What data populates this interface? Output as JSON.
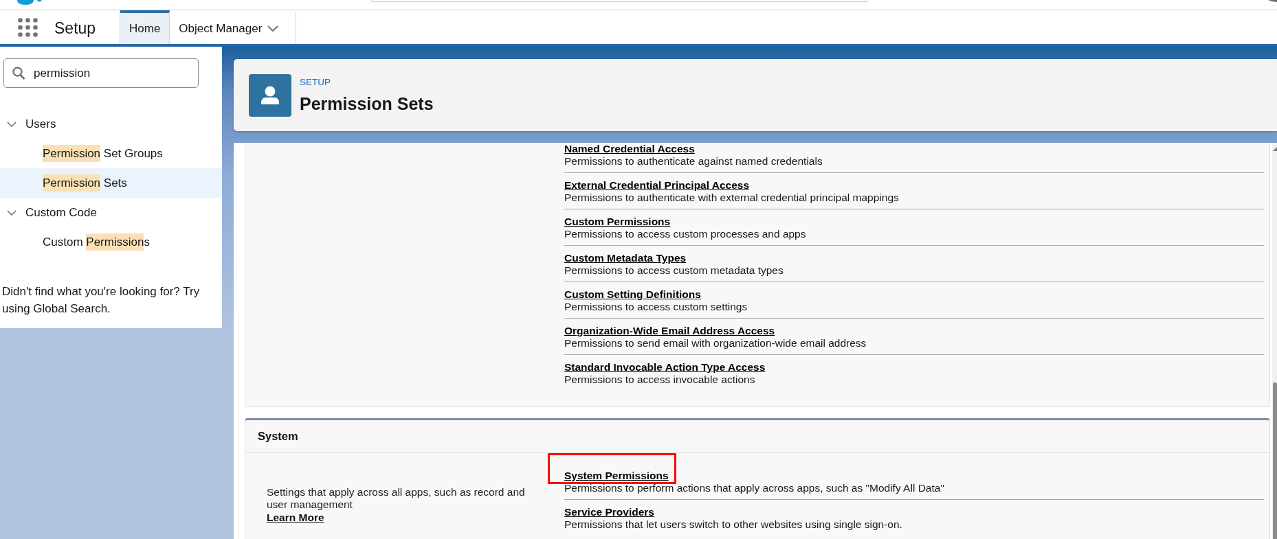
{
  "header": {
    "app_name": "Setup",
    "tabs": [
      {
        "label": "Home",
        "selected": true,
        "has_menu": false
      },
      {
        "label": "Object Manager",
        "selected": false,
        "has_menu": true
      }
    ]
  },
  "sidebar": {
    "search": {
      "value": "permission"
    },
    "tree": [
      {
        "label": "Users",
        "expanded": true,
        "children": [
          {
            "parts": [
              {
                "text": "Permission",
                "highlighted": true
              },
              {
                "text": " Set Groups",
                "highlighted": false
              }
            ],
            "selected": false
          },
          {
            "parts": [
              {
                "text": "Permission",
                "highlighted": true
              },
              {
                "text": " Sets",
                "highlighted": false
              }
            ],
            "selected": true
          }
        ]
      },
      {
        "label": "Custom Code",
        "expanded": true,
        "children": [
          {
            "parts": [
              {
                "text": "Custom ",
                "highlighted": false
              },
              {
                "text": "Permission",
                "highlighted": true
              },
              {
                "text": "s",
                "highlighted": false
              }
            ],
            "selected": false
          }
        ]
      }
    ],
    "footer": "Didn't find what you're looking for? Try using Global Search."
  },
  "page_header": {
    "eyebrow": "SETUP",
    "title": "Permission Sets"
  },
  "sections": [
    {
      "items": [
        {
          "title": "Named Credential Access",
          "description": "Permissions to authenticate against named credentials",
          "annotated": false
        },
        {
          "title": "External Credential Principal Access",
          "description": "Permissions to authenticate with external credential principal mappings",
          "annotated": false
        },
        {
          "title": "Custom Permissions",
          "description": "Permissions to access custom processes and apps",
          "annotated": false
        },
        {
          "title": "Custom Metadata Types",
          "description": "Permissions to access custom metadata types",
          "annotated": false
        },
        {
          "title": "Custom Setting Definitions",
          "description": "Permissions to access custom settings",
          "annotated": false
        },
        {
          "title": "Organization-Wide Email Address Access",
          "description": "Permissions to send email with organization-wide email address",
          "annotated": false
        },
        {
          "title": "Standard Invocable Action Type Access",
          "description": "Permissions to access invocable actions",
          "annotated": false
        }
      ]
    },
    {
      "title": "System",
      "description": "Settings that apply across all apps, such as record and user management",
      "link": "Learn More",
      "items": [
        {
          "title": "System Permissions",
          "description": "Permissions to perform actions that apply across apps, such as \"Modify All Data\"",
          "annotated": true
        },
        {
          "title": "Service Providers",
          "description": "Permissions that let users switch to other websites using single sign-on.",
          "annotated": false
        }
      ]
    }
  ]
}
